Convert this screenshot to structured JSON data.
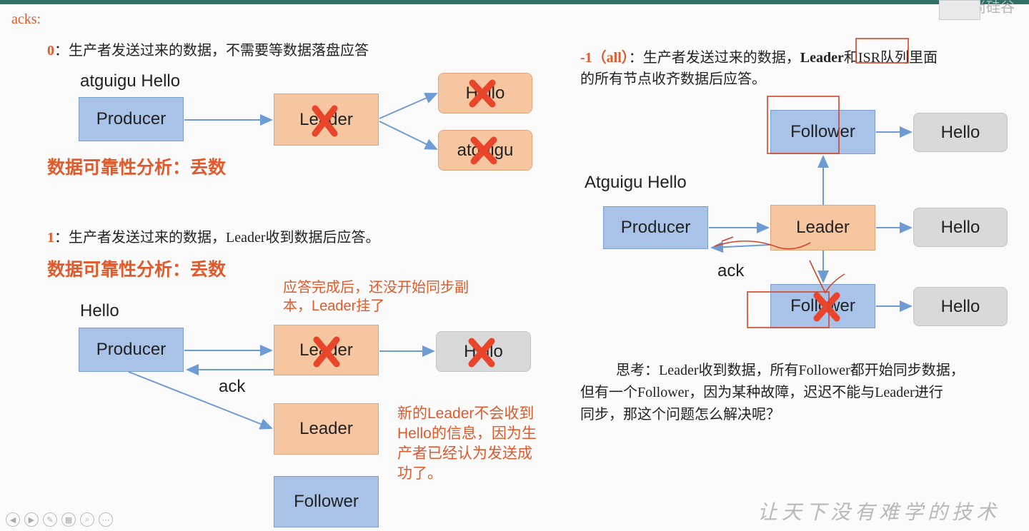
{
  "header": {
    "topright_text": "尚硅谷"
  },
  "acks_label": "acks:",
  "sec0": {
    "number": "0",
    "desc": "：生产者发送过来的数据，不需要等数据落盘应答",
    "msg_label": "atguigu  Hello",
    "producer": "Producer",
    "leader": "Leader",
    "out1": "Hello",
    "out2": "atguigu",
    "reliability": "数据可靠性分析：丢数"
  },
  "sec1": {
    "number": "1",
    "desc": "：生产者发送过来的数据，Leader收到数据后应答。",
    "reliability": "数据可靠性分析：丢数",
    "note_top": "应答完成后，还没开始同步副本，Leader挂了",
    "msg_label": "Hello",
    "producer": "Producer",
    "leader": "Leader",
    "out": "Hello",
    "ack": "ack",
    "new_leader": "Leader",
    "follower": "Follower",
    "note_side": "新的Leader不会收到Hello的信息，因为生产者已经认为发送成功了。"
  },
  "secm1": {
    "number": "-1（all）",
    "desc_a": "：生产者发送过来的数据，",
    "leader_word": "Leader",
    "desc_b": "和ISR队列里面",
    "desc_line2": "的所有节点收齐数据后应答。",
    "msg_label": "Atguigu Hello",
    "producer": "Producer",
    "leader": "Leader",
    "follower_top": "Follower",
    "follower_bottom": "Follower",
    "hello1": "Hello",
    "hello2": "Hello",
    "hello3": "Hello",
    "ack": "ack",
    "think_line1": "思考：Leader收到数据，所有Follower都开始同步数据，",
    "think_line2": "但有一个Follower，因为某种故障，迟迟不能与Leader进行",
    "think_line3": "同步，那这个问题怎么解决呢？"
  },
  "watermark": "让天下没有难学的技术",
  "colors": {
    "accent_red": "#e05a2b",
    "producer_blue": "#a9c2e8",
    "leader_orange": "#f6c6a0",
    "grey": "#d9d9d9",
    "arrow": "#6f9bd4"
  }
}
